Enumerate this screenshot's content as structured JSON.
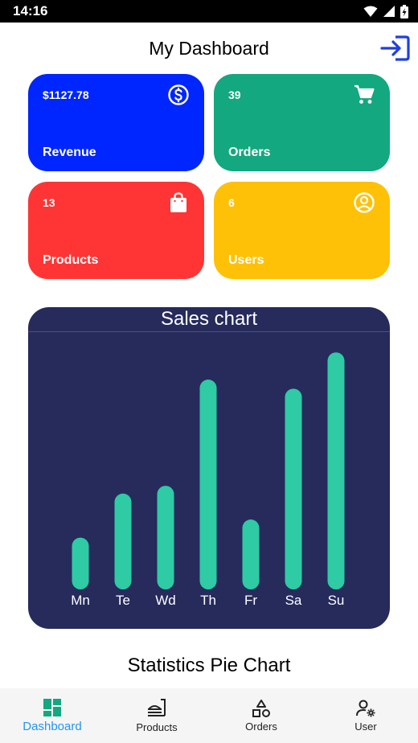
{
  "status_bar": {
    "time": "14:16"
  },
  "header": {
    "title": "My Dashboard"
  },
  "cards": [
    {
      "value": "$1127.78",
      "label": "Revenue",
      "color": "#0026ff",
      "icon": "dollar-circle-icon"
    },
    {
      "value": "39",
      "label": "Orders",
      "color": "#13a880",
      "icon": "shopping-cart-icon"
    },
    {
      "value": "13",
      "label": "Products",
      "color": "#ff3535",
      "icon": "shopping-bag-icon"
    },
    {
      "value": "6",
      "label": "Users",
      "color": "#ffc107",
      "icon": "user-circle-icon"
    }
  ],
  "chart_data": {
    "type": "bar",
    "title": "Sales chart",
    "categories": [
      "Mn",
      "Te",
      "Wd",
      "Th",
      "Fr",
      "Sa",
      "Su"
    ],
    "values": [
      4,
      7.4,
      8,
      16.2,
      5.4,
      15.5,
      18.3
    ],
    "ylim": [
      0,
      18.5
    ],
    "grid": false,
    "bar_color": "#2ecba4",
    "background": "#262b5c"
  },
  "pie_section": {
    "title": "Statistics Pie Chart"
  },
  "bottom_nav": [
    {
      "label": "Dashboard",
      "icon": "dashboard-icon",
      "active": true
    },
    {
      "label": "Products",
      "icon": "products-icon",
      "active": false
    },
    {
      "label": "Orders",
      "icon": "orders-icon",
      "active": false
    },
    {
      "label": "User",
      "icon": "user-settings-icon",
      "active": false
    }
  ]
}
